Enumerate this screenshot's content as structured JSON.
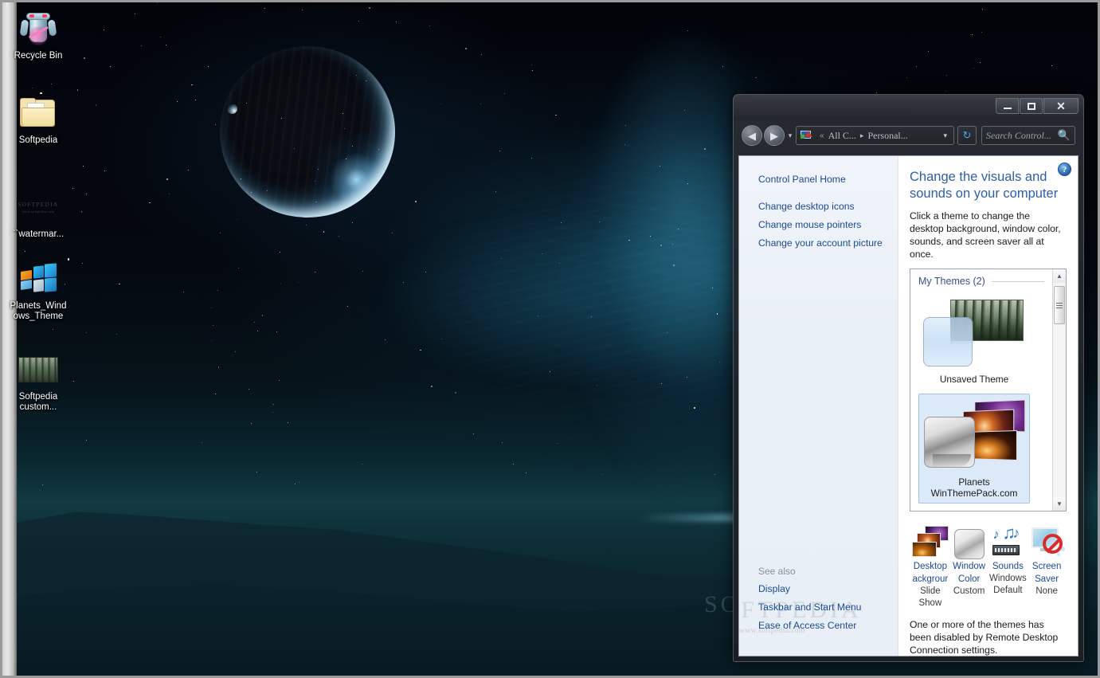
{
  "desktop": {
    "icons": [
      {
        "name": "recycle-bin",
        "label": "Recycle Bin",
        "icon": "recycle-bin-icon"
      },
      {
        "name": "softpedia-folder",
        "label": "Softpedia",
        "icon": "folder-icon"
      },
      {
        "name": "watermark-file",
        "label": "``watermar...",
        "icon": "image-file-icon"
      },
      {
        "name": "planets-windows-theme",
        "label": "Planets_Windows_Theme",
        "label_line1": "Planets_Wind",
        "label_line2": "ows_Theme",
        "icon": "windows-theme-icon"
      },
      {
        "name": "softpedia-custom",
        "label": "Softpedia custom...",
        "label_line1": "Softpedia",
        "label_line2": "custom...",
        "icon": "theme-thumbnail-icon"
      }
    ],
    "watermark": "SOFTPEDIA",
    "watermark_sub": "www.softpedia.com"
  },
  "window": {
    "titlebar": {
      "minimize_label": "–",
      "maximize_label": "□",
      "close_label": "✕"
    },
    "toolbar": {
      "back_label": "◀",
      "forward_label": "▶",
      "history_dropdown_label": "▾",
      "address_icon": "personalization-icon",
      "address_overflow": "«",
      "breadcrumb_1": "All C...",
      "breadcrumb_sep": "▸",
      "breadcrumb_2": "Personal...",
      "address_dropdown_label": "▾",
      "refresh_label": "↻",
      "search_placeholder": "Search Control...",
      "search_value": "",
      "search_icon": "magnifier-icon"
    },
    "nav": {
      "home_label": "Control Panel Home",
      "links": [
        "Change desktop icons",
        "Change mouse pointers",
        "Change your account picture"
      ],
      "see_also_title": "See also",
      "see_also_links": [
        "Display",
        "Taskbar and Start Menu",
        "Ease of Access Center"
      ],
      "watermark": "SOFTPEDIA",
      "watermark_sub": "www.softpedia.com"
    },
    "content": {
      "help_label": "?",
      "title": "Change the visuals and sounds on your computer",
      "description": "Click a theme to change the desktop background, window color, sounds, and screen saver all at once.",
      "themes_group_label": "My Themes (2)",
      "themes": [
        {
          "name": "unsaved-theme",
          "label": "Unsaved Theme",
          "label_line1": "Unsaved Theme",
          "label_line2": "",
          "selected": false
        },
        {
          "name": "planets-theme",
          "label": "Planets WinThemePack.com",
          "label_line1": "Planets",
          "label_line2": "WinThemePack.com",
          "selected": true
        }
      ],
      "scrollbar": {
        "up_label": "▲",
        "down_label": "▼"
      },
      "settings": [
        {
          "name": "desktop-background",
          "label_line1": "Desktop",
          "label_line2": "ackgrour",
          "value_line1": "Slide",
          "value_line2": "Show",
          "icon": "desktop-background-icon"
        },
        {
          "name": "window-color",
          "label_line1": "Window",
          "label_line2": "Color",
          "value_line1": "Custom",
          "value_line2": "",
          "icon": "window-color-icon"
        },
        {
          "name": "sounds",
          "label_line1": "Sounds",
          "label_line2": "Windows",
          "value_line1": "Default",
          "value_line2": "",
          "icon": "sounds-icon"
        },
        {
          "name": "screen-saver",
          "label_line1": "Screen",
          "label_line2": "Saver",
          "value_line1": "None",
          "value_line2": "",
          "icon": "screen-saver-icon"
        }
      ],
      "footer_note": "One or more of the themes has been disabled by Remote Desktop Connection settings."
    }
  },
  "colors": {
    "link_blue": "#1a4a92",
    "title_blue": "#2b5faa",
    "selection_blue": "#dbe9f8",
    "selection_border": "#9fc4e8",
    "window_chrome": "#2b2f36"
  }
}
